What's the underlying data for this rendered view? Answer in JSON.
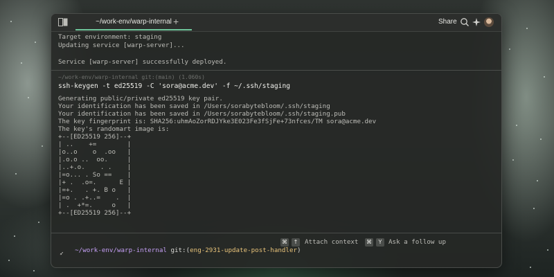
{
  "window": {
    "tab_title": "~/work-env/warp-internal",
    "new_tab_label": "+",
    "share_label": "Share",
    "icons": [
      "panels-icon",
      "search-icon",
      "sparkle-icon",
      "avatar"
    ]
  },
  "previous_block": {
    "lines": [
      "Target environment: staging",
      "Updating service [warp-server]...",
      "",
      "Service [warp-server] successfully deployed."
    ]
  },
  "current_block": {
    "prompt_meta": "~/work-env/warp-internal git:(main) (1.060s)",
    "command": "ssh-keygen -t ed25519 -C 'sora@acme.dev' -f ~/.ssh/staging",
    "output": [
      "Generating public/private ed25519 key pair.",
      "Your identification has been saved in /Users/sorabytebloom/.ssh/staging",
      "Your identification has been saved in /Users/sorabytebloom/.ssh/staging.pub",
      "The key fingerprint is: SHA256:uhmAoZorRDJYke3E023Fe3fSjFe+73nfces/TM sora@acme.dev",
      "The key's randomart image is:",
      "+--[ED25519 256]--+",
      "| ..    +=        |",
      "|o..o    o  .oo   |",
      "|.o.o ..  oo.     |",
      "|..+.o.    . .    |",
      "|=o... . So ==    |",
      "|+ .  .o=.      E |",
      "|=+.   . +. B o   |",
      "|=o . .+..=    .  |",
      "| .  +*=.     o   |",
      "+--[ED25519 256]--+"
    ]
  },
  "input": {
    "path": "~/work-env/warp-internal",
    "git_prefix": "git:(",
    "branch": "eng-2931-update-post-handler",
    "git_suffix": ")",
    "attach_key1": "⌘",
    "attach_key2": "↑",
    "attach_label": "Attach context",
    "followup_key1": "⌘",
    "followup_key2": "Y",
    "followup_label": "Ask a follow up",
    "cursor_glyph": "➶"
  },
  "colors": {
    "accent": "#6fc79b",
    "path": "#c49ff5",
    "branch": "#e8c37a"
  }
}
